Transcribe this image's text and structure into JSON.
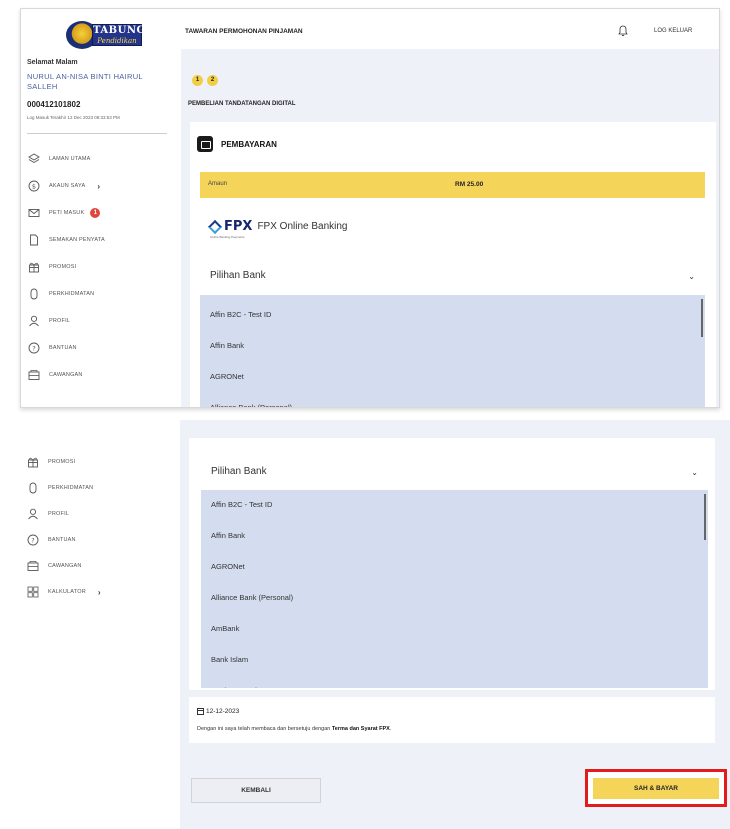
{
  "logo": {
    "line1": "TABUNG",
    "line2": "Pendidikan"
  },
  "user": {
    "greeting": "Selamat Malam",
    "name": "NURUL AN-NISA BINTI HAIRUL SALLEH",
    "id": "000412101802",
    "last_login": "Log Masuk Terakhir 12 Dec 2023 08:33:53 PM"
  },
  "sidebar_top": [
    {
      "label": "LAMAN UTAMA",
      "icon": "layers-icon"
    },
    {
      "label": "AKAUN SAYA",
      "icon": "dollar-icon",
      "chevron": "›"
    },
    {
      "label": "PETI MASUK",
      "icon": "mail-icon",
      "badge": "1"
    },
    {
      "label": "SEMAKAN PENYATA",
      "icon": "document-icon"
    },
    {
      "label": "PROMOSI",
      "icon": "gift-icon"
    },
    {
      "label": "PERKHIDMATAN",
      "icon": "mouse-icon"
    },
    {
      "label": "PROFIL",
      "icon": "user-icon"
    },
    {
      "label": "BANTUAN",
      "icon": "help-icon"
    },
    {
      "label": "CAWANGAN",
      "icon": "branch-icon"
    }
  ],
  "sidebar_bottom": [
    {
      "label": "PROMOSI",
      "icon": "gift-icon"
    },
    {
      "label": "PERKHIDMATAN",
      "icon": "mouse-icon"
    },
    {
      "label": "PROFIL",
      "icon": "user-icon"
    },
    {
      "label": "BANTUAN",
      "icon": "help-icon"
    },
    {
      "label": "CAWANGAN",
      "icon": "branch-icon"
    },
    {
      "label": "KALKULATOR",
      "icon": "calculator-icon",
      "chevron": "›"
    }
  ],
  "header": {
    "title": "TAWARAN PERMOHONAN PINJAMAN",
    "logout": "LOG KELUAR"
  },
  "steps": [
    "1",
    "2"
  ],
  "section_title": "PEMBELIAN TANDATANGAN DIGITAL",
  "payment": {
    "title": "PEMBAYARAN",
    "amount_label": "Amaun",
    "amount_value": "RM 25.00",
    "fpx_mark": "FPX",
    "fpx_text": "FPX Online Banking",
    "fpx_sub": "Online Banking Payments",
    "bank_select_label": "Pilihan Bank",
    "chevron": "⌄"
  },
  "banks_top": [
    "Affin B2C - Test ID",
    "Affin Bank",
    "AGRONet",
    "Alliance Bank (Personal)"
  ],
  "banks_bottom": [
    "Affin B2C - Test ID",
    "Affin Bank",
    "AGRONet",
    "Alliance Bank (Personal)",
    "AmBank",
    "Bank Islam",
    "Bank Muamalat"
  ],
  "date": "12-12-2023",
  "terms": {
    "prefix": "Dengan ini saya telah membaca dan bersetuju dengan ",
    "link": "Terma dan Syarat FPX",
    "suffix": "."
  },
  "buttons": {
    "back": "KEMBALI",
    "pay": "SAH & BAYAR"
  },
  "colors": {
    "accent": "#f4d55a",
    "list_bg": "#d3ddef",
    "highlight": "#e21c1c",
    "page_bg": "#eef1f8"
  }
}
